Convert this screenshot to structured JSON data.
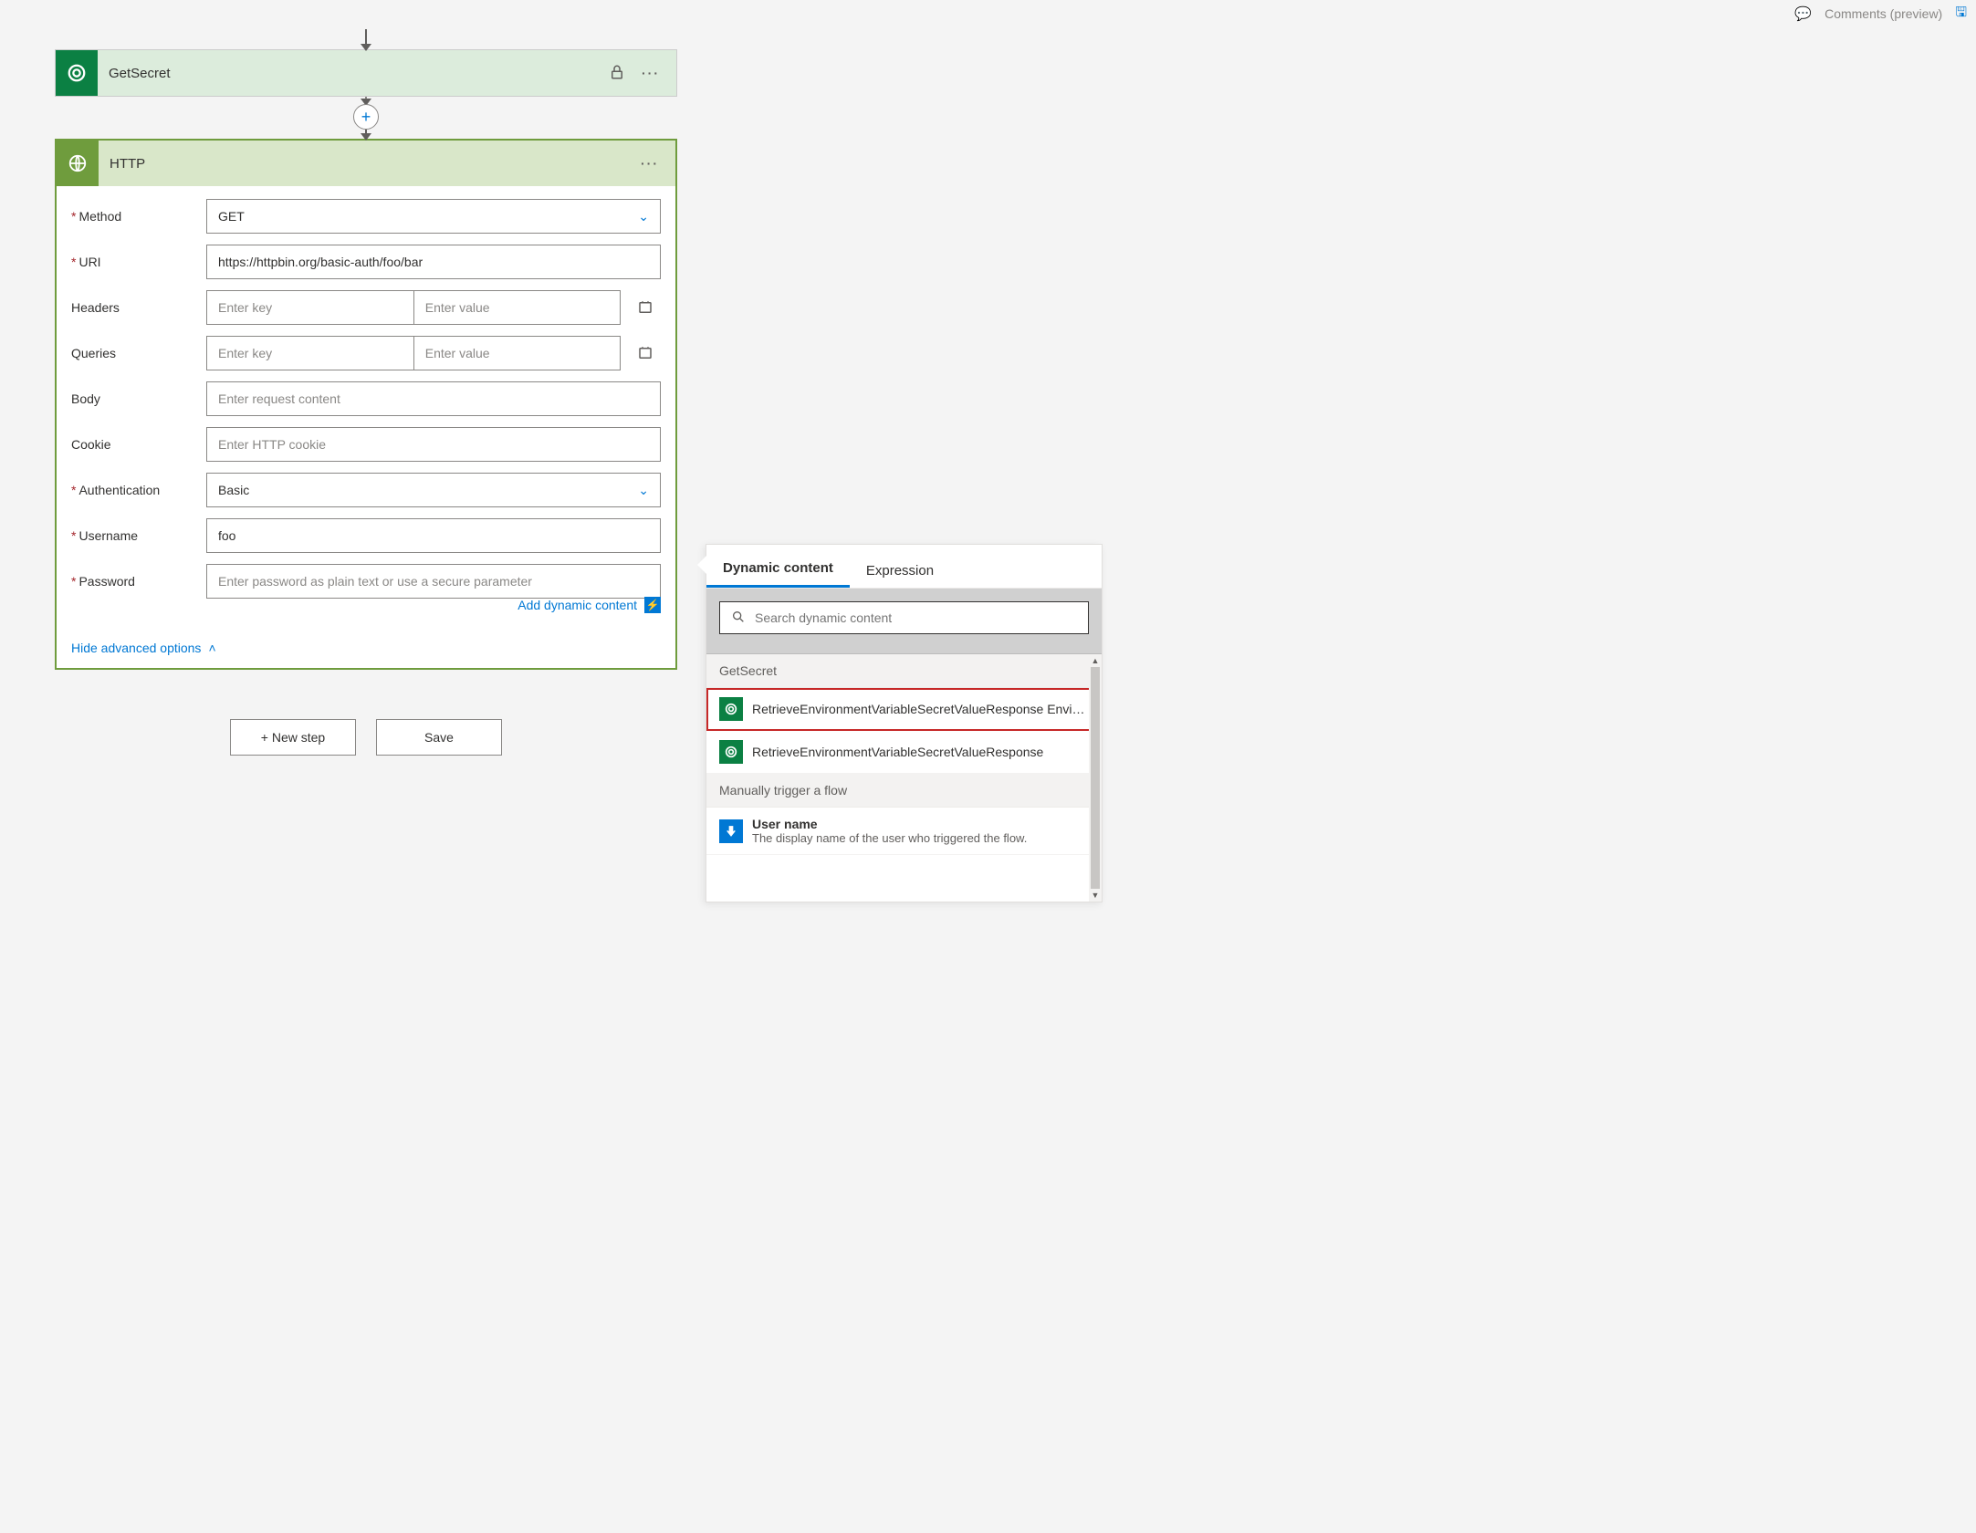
{
  "topbar": {
    "comments_label": "Comments (preview)"
  },
  "getsecret": {
    "title": "GetSecret"
  },
  "http": {
    "title": "HTTP",
    "fields": {
      "method": {
        "label": "Method",
        "value": "GET",
        "required": true
      },
      "uri": {
        "label": "URI",
        "value": "https://httpbin.org/basic-auth/foo/bar",
        "required": true
      },
      "headers": {
        "label": "Headers",
        "key_placeholder": "Enter key",
        "value_placeholder": "Enter value"
      },
      "queries": {
        "label": "Queries",
        "key_placeholder": "Enter key",
        "value_placeholder": "Enter value"
      },
      "body": {
        "label": "Body",
        "placeholder": "Enter request content"
      },
      "cookie": {
        "label": "Cookie",
        "placeholder": "Enter HTTP cookie"
      },
      "authentication": {
        "label": "Authentication",
        "value": "Basic",
        "required": true
      },
      "username": {
        "label": "Username",
        "value": "foo",
        "required": true
      },
      "password": {
        "label": "Password",
        "placeholder": "Enter password as plain text or use a secure parameter",
        "required": true
      }
    },
    "add_dynamic_content": "Add dynamic content",
    "hide_advanced": "Hide advanced options"
  },
  "footer": {
    "new_step": "+ New step",
    "save": "Save"
  },
  "dynamic_panel": {
    "tabs": {
      "dynamic": "Dynamic content",
      "expression": "Expression"
    },
    "search_placeholder": "Search dynamic content",
    "sections": [
      {
        "title": "GetSecret",
        "items": [
          {
            "name": "RetrieveEnvironmentVariableSecretValueResponse Envi…",
            "icon": "green",
            "highlighted": true
          },
          {
            "name": "RetrieveEnvironmentVariableSecretValueResponse",
            "icon": "green"
          }
        ]
      },
      {
        "title": "Manually trigger a flow",
        "items": [
          {
            "name": "User name",
            "desc": "The display name of the user who triggered the flow.",
            "icon": "blue"
          }
        ]
      }
    ]
  }
}
